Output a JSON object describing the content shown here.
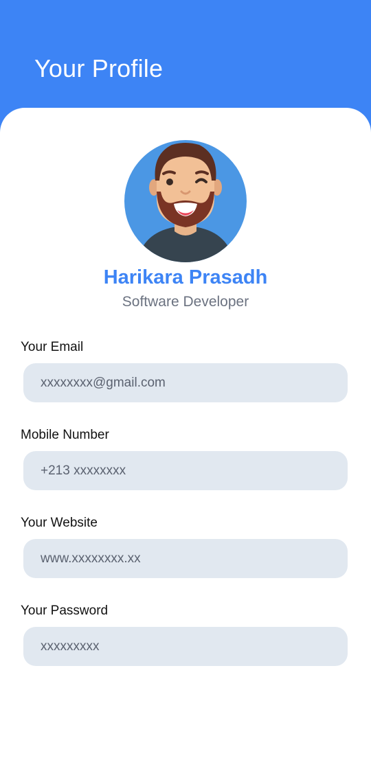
{
  "header": {
    "title": "Your Profile"
  },
  "profile": {
    "name": "Harikara Prasadh",
    "role": "Software Developer",
    "avatar_icon": "avatar-winking-bearded-man-icon"
  },
  "fields": {
    "email": {
      "label": "Your Email",
      "placeholder": "xxxxxxxx@gmail.com"
    },
    "mobile": {
      "label": "Mobile Number",
      "placeholder": "+213 xxxxxxxx"
    },
    "website": {
      "label": "Your Website",
      "placeholder": "www.xxxxxxxx.xx"
    },
    "password": {
      "label": "Your Password",
      "placeholder": "xxxxxxxxx"
    }
  },
  "colors": {
    "primary": "#3d84f5",
    "input_bg": "#e1e8f0",
    "subtitle": "#6b7280"
  }
}
